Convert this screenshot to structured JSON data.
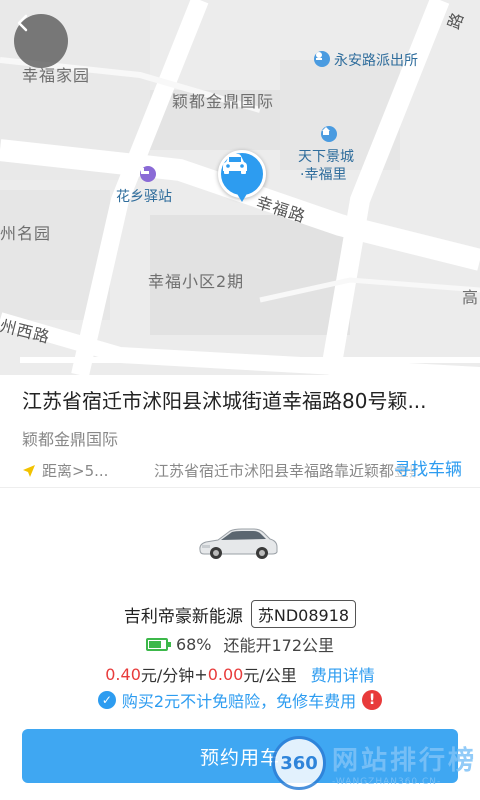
{
  "map": {
    "labels": {
      "xingfu_jiayuan": "幸福家园",
      "yingdu_jinding": "颖都金鼎国际",
      "yongan_police": "永安路派出所",
      "tianxia_jingcheng": "天下景城",
      "xingfuli": "·幸福里",
      "huaxiang_inn": "花乡驿站",
      "xingfu_road": "幸福路",
      "zhou_mingyuan": "州名园",
      "xingfu_xiaoqu": "幸福小区2期",
      "zhou_xilu": "州西路",
      "gao": "高",
      "road_right": "路"
    }
  },
  "address": {
    "title": "江苏省宿迁市沭阳县沭城街道幸福路80号颖...",
    "subtitle": "颖都金鼎国际",
    "distance": "距离>5...",
    "nearby": "江苏省宿迁市沭阳县幸福路靠近颖都金鼎国际",
    "find_car": "寻找车辆"
  },
  "car": {
    "model": "吉利帝豪新能源",
    "plate": "苏ND08918",
    "battery_percent": "68%",
    "range_text": "还能开172公里",
    "price_minute": "0.40",
    "price_minute_unit": "元/分钟",
    "plus": "+",
    "price_km": "0.00",
    "price_km_unit": "元/公里",
    "fee_detail": "费用详情",
    "insurance_text": "购买2元不计免赔险，免修车费用"
  },
  "actions": {
    "book": "预约用车"
  },
  "watermark": {
    "badge": "360",
    "title": "网站排行榜",
    "url": "-WANGZHAN360.CN-"
  },
  "colors": {
    "accent": "#2d9cf0",
    "button": "#3fa7f2",
    "price_red": "#e83b3b",
    "battery_green": "#3cb84a"
  }
}
